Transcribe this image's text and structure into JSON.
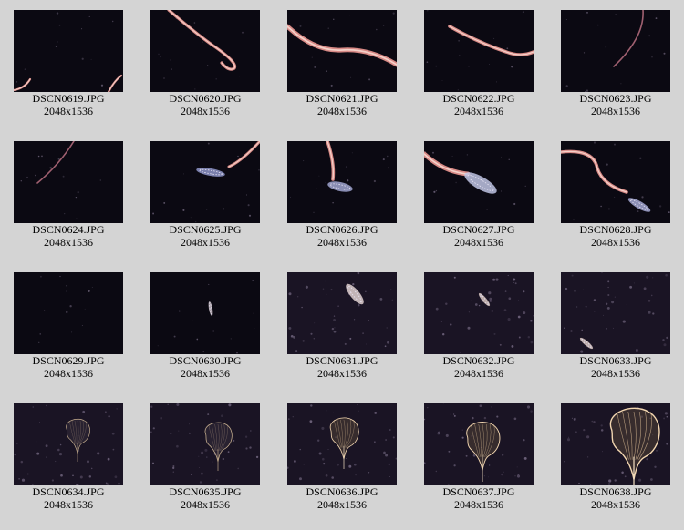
{
  "gallery": {
    "items": [
      {
        "filename": "DSCN0619.JPG",
        "dimensions": "2048x1536",
        "scene": "worm-corner"
      },
      {
        "filename": "DSCN0620.JPG",
        "dimensions": "2048x1536",
        "scene": "worm-curl"
      },
      {
        "filename": "DSCN0621.JPG",
        "dimensions": "2048x1536",
        "scene": "worm-thick"
      },
      {
        "filename": "DSCN0622.JPG",
        "dimensions": "2048x1536",
        "scene": "worm-diagonal"
      },
      {
        "filename": "DSCN0623.JPG",
        "dimensions": "2048x1536",
        "scene": "worm-faint"
      },
      {
        "filename": "DSCN0624.JPG",
        "dimensions": "2048x1536",
        "scene": "worm-faint-left"
      },
      {
        "filename": "DSCN0625.JPG",
        "dimensions": "2048x1536",
        "scene": "worm-larva"
      },
      {
        "filename": "DSCN0626.JPG",
        "dimensions": "2048x1536",
        "scene": "worm-larva-vertical"
      },
      {
        "filename": "DSCN0627.JPG",
        "dimensions": "2048x1536",
        "scene": "worm-larva-large"
      },
      {
        "filename": "DSCN0628.JPG",
        "dimensions": "2048x1536",
        "scene": "worm-larva-right"
      },
      {
        "filename": "DSCN0629.JPG",
        "dimensions": "2048x1536",
        "scene": "dark-specks"
      },
      {
        "filename": "DSCN0630.JPG",
        "dimensions": "2048x1536",
        "scene": "larva-small"
      },
      {
        "filename": "DSCN0631.JPG",
        "dimensions": "2048x1536",
        "scene": "larva-big"
      },
      {
        "filename": "DSCN0632.JPG",
        "dimensions": "2048x1536",
        "scene": "larva-medium"
      },
      {
        "filename": "DSCN0633.JPG",
        "dimensions": "2048x1536",
        "scene": "larva-corner"
      },
      {
        "filename": "DSCN0634.JPG",
        "dimensions": "2048x1536",
        "scene": "net-small"
      },
      {
        "filename": "DSCN0635.JPG",
        "dimensions": "2048x1536",
        "scene": "net-medium"
      },
      {
        "filename": "DSCN0636.JPG",
        "dimensions": "2048x1536",
        "scene": "net-medium-bright"
      },
      {
        "filename": "DSCN0637.JPG",
        "dimensions": "2048x1536",
        "scene": "net-bright"
      },
      {
        "filename": "DSCN0638.JPG",
        "dimensions": "2048x1536",
        "scene": "net-large"
      }
    ]
  }
}
